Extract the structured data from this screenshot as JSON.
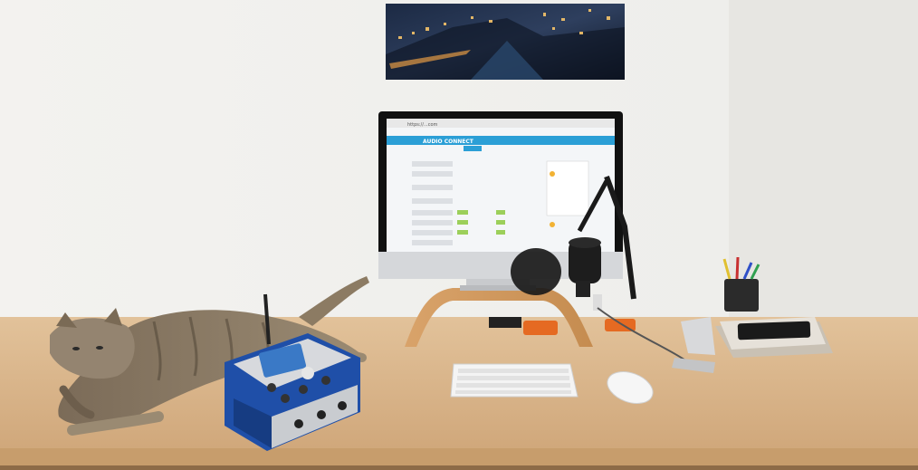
{
  "scene": {
    "kind": "photo",
    "subject": "home office desk",
    "colors": {
      "wall": "#ecebe8",
      "desk": "#d9b58a",
      "screen_header": "#2b9fd6",
      "screen_bg": "#f4f6f8",
      "cat": "#8a7a64",
      "device_blue": "#1f4fa8",
      "orange_drive": "#e56a22"
    }
  },
  "screen": {
    "app_brand": "AUDIO CONNECT",
    "url": "https://...com"
  },
  "objects": [
    "poster-city-night",
    "imac-monitor",
    "wooden-monitor-stand",
    "microphone-with-boom-arm",
    "pop-filter",
    "keyboard",
    "mouse",
    "cat",
    "audio-codec-device",
    "pen-cup",
    "tablet-stand",
    "smartphone",
    "notebooks"
  ]
}
